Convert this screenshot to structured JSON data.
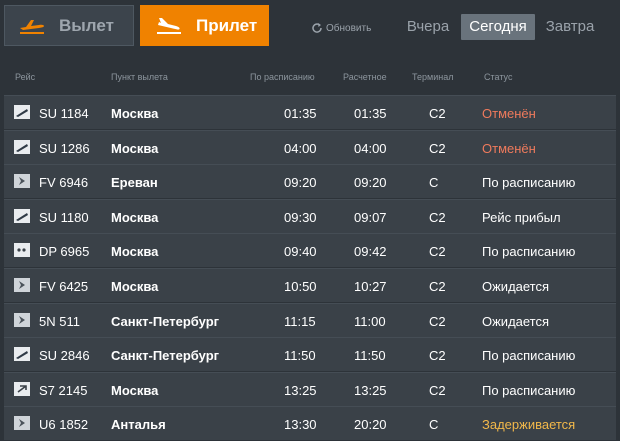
{
  "tabs": {
    "departure_label": "Вылет",
    "arrival_label": "Прилет"
  },
  "refresh_label": "Обновить",
  "days": {
    "yesterday": "Вчера",
    "today": "Сегодня",
    "tomorrow": "Завтра"
  },
  "columns": {
    "flight": "Рейс",
    "origin": "Пункт вылета",
    "scheduled": "По расписанию",
    "estimated": "Расчетное",
    "terminal": "Терминал",
    "status": "Статус"
  },
  "colors": {
    "accent": "#f08200",
    "cancelled": "#ef7a5c",
    "delayed": "#f2b84a",
    "row_bg": "#3a4148",
    "page_bg": "#2d3339"
  },
  "flights": [
    {
      "airline_icon": "aeroflot-logo-icon",
      "flight": "SU 1184",
      "origin": "Москва",
      "scheduled": "01:35",
      "estimated": "01:35",
      "terminal": "C2",
      "status": "Отменён",
      "status_kind": "cancel"
    },
    {
      "airline_icon": "aeroflot-logo-icon",
      "flight": "SU 1286",
      "origin": "Москва",
      "scheduled": "04:00",
      "estimated": "04:00",
      "terminal": "C2",
      "status": "Отменён",
      "status_kind": "cancel"
    },
    {
      "airline_icon": "airline-logo-icon",
      "flight": "FV 6946",
      "origin": "Ереван",
      "scheduled": "09:20",
      "estimated": "09:20",
      "terminal": "C",
      "status": "По расписанию",
      "status_kind": "norm"
    },
    {
      "airline_icon": "aeroflot-logo-icon",
      "flight": "SU 1180",
      "origin": "Москва",
      "scheduled": "09:30",
      "estimated": "09:07",
      "terminal": "C2",
      "status": "Рейс прибыл",
      "status_kind": "norm"
    },
    {
      "airline_icon": "pobeda-logo-icon",
      "flight": "DP 6965",
      "origin": "Москва",
      "scheduled": "09:40",
      "estimated": "09:42",
      "terminal": "C2",
      "status": "По расписанию",
      "status_kind": "norm"
    },
    {
      "airline_icon": "airline-logo-icon",
      "flight": "FV 6425",
      "origin": "Москва",
      "scheduled": "10:50",
      "estimated": "10:27",
      "terminal": "C2",
      "status": "Ожидается",
      "status_kind": "norm"
    },
    {
      "airline_icon": "airline-logo-icon",
      "flight": "5N 511",
      "origin": "Санкт-Петербург",
      "scheduled": "11:15",
      "estimated": "11:00",
      "terminal": "C2",
      "status": "Ожидается",
      "status_kind": "norm"
    },
    {
      "airline_icon": "aeroflot-logo-icon",
      "flight": "SU 2846",
      "origin": "Санкт-Петербург",
      "scheduled": "11:50",
      "estimated": "11:50",
      "terminal": "C2",
      "status": "По расписанию",
      "status_kind": "norm"
    },
    {
      "airline_icon": "s7-logo-icon",
      "flight": "S7 2145",
      "origin": "Москва",
      "scheduled": "13:25",
      "estimated": "13:25",
      "terminal": "C2",
      "status": "По расписанию",
      "status_kind": "norm"
    },
    {
      "airline_icon": "airline-logo-icon",
      "flight": "U6 1852",
      "origin": "Анталья",
      "scheduled": "13:30",
      "estimated": "20:20",
      "terminal": "C",
      "status": "Задерживается",
      "status_kind": "delay"
    }
  ]
}
